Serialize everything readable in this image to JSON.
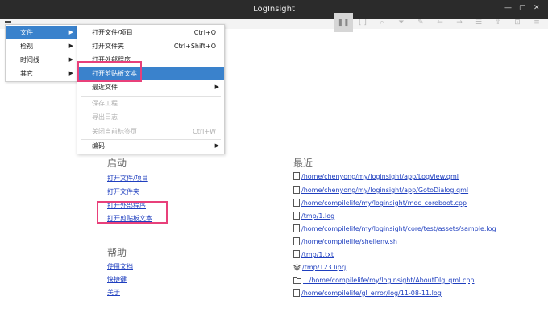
{
  "window": {
    "title": "LogInsight"
  },
  "main_menu": [
    {
      "label": "文件"
    },
    {
      "label": "检视"
    },
    {
      "label": "时间线"
    },
    {
      "label": "其它"
    }
  ],
  "file_menu": [
    {
      "label": "打开文件/项目",
      "shortcut": "Ctrl+O"
    },
    {
      "label": "打开文件夹",
      "shortcut": "Ctrl+Shift+O"
    },
    {
      "label": "打开外部程序",
      "shortcut": ""
    },
    {
      "label": "打开剪贴板文本",
      "shortcut": ""
    },
    {
      "label": "最近文件",
      "shortcut": ""
    },
    {
      "label": "保存工程",
      "shortcut": ""
    },
    {
      "label": "导出日志",
      "shortcut": ""
    },
    {
      "label": "关闭当前标签页",
      "shortcut": "Ctrl+W"
    },
    {
      "label": "编码",
      "shortcut": ""
    }
  ],
  "start": {
    "heading": "启动",
    "links": [
      "打开文件/项目",
      "打开文件夹",
      "打开外部程序",
      "打开剪贴板文本"
    ]
  },
  "help": {
    "heading": "帮助",
    "links": [
      "使用文档",
      "快捷键",
      "关于"
    ]
  },
  "recent": {
    "heading": "最近",
    "items": [
      {
        "icon": "file-icon",
        "path": "/home/chenyong/my/loginsight/app/LogView.qml"
      },
      {
        "icon": "file-icon",
        "path": "/home/chenyong/my/loginsight/app/GotoDialog.qml"
      },
      {
        "icon": "file-icon",
        "path": "/home/compilelife/my/loginsight/moc_coreboot.cpp"
      },
      {
        "icon": "file-icon",
        "path": "/tmp/1.log"
      },
      {
        "icon": "file-icon",
        "path": "/home/compilelife/my/loginsight/core/test/assets/sample.log"
      },
      {
        "icon": "file-icon",
        "path": "/home/compilelife/shellenv.sh"
      },
      {
        "icon": "file-icon",
        "path": "/tmp/1.txt"
      },
      {
        "icon": "layers-icon",
        "path": "/tmp/123.liprj"
      },
      {
        "icon": "folder-icon",
        "path": ".../home/compilelife/my/loginsight/AboutDlg_qml.cpp"
      },
      {
        "icon": "file-icon",
        "path": "/home/compilelife/gl_error/log/11-08-11.log"
      }
    ]
  },
  "toolbar_icons": [
    "pause-icon",
    "bracket-icon",
    "search-icon",
    "filter-icon",
    "highlight-icon",
    "back-icon",
    "forward-icon",
    "align-icon",
    "upload-icon",
    "lock-icon",
    "menu-icon"
  ],
  "colors": {
    "titlebar": "#2b2b2b",
    "selection": "#3a82cc",
    "link": "#1f3fbf",
    "highlight_box": "#e8407a"
  }
}
